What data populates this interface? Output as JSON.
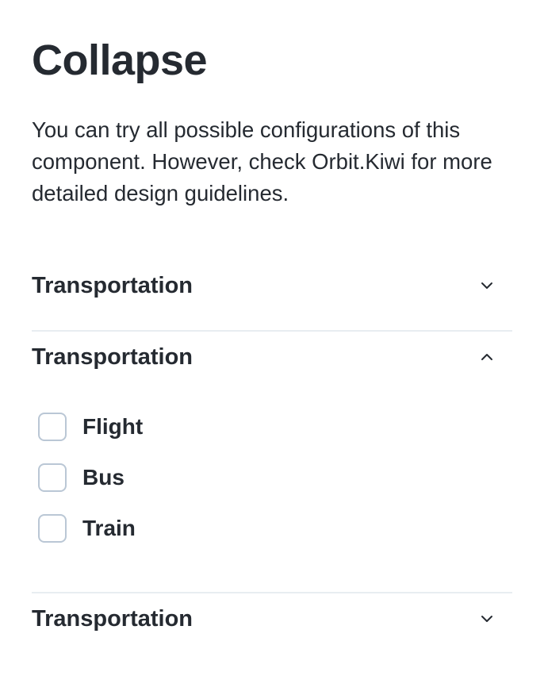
{
  "page": {
    "title": "Collapse",
    "description": "You can try all possible configurations of this component. However, check Orbit.Kiwi for more detailed design guidelines."
  },
  "collapses": [
    {
      "title": "Transportation",
      "expanded": false,
      "chevron_icon": "chevron-down-icon"
    },
    {
      "title": "Transportation",
      "expanded": true,
      "chevron_icon": "chevron-up-icon",
      "options": [
        {
          "label": "Flight",
          "checked": false
        },
        {
          "label": "Bus",
          "checked": false
        },
        {
          "label": "Train",
          "checked": false
        }
      ]
    },
    {
      "title": "Transportation",
      "expanded": false,
      "chevron_icon": "chevron-down-icon"
    }
  ]
}
